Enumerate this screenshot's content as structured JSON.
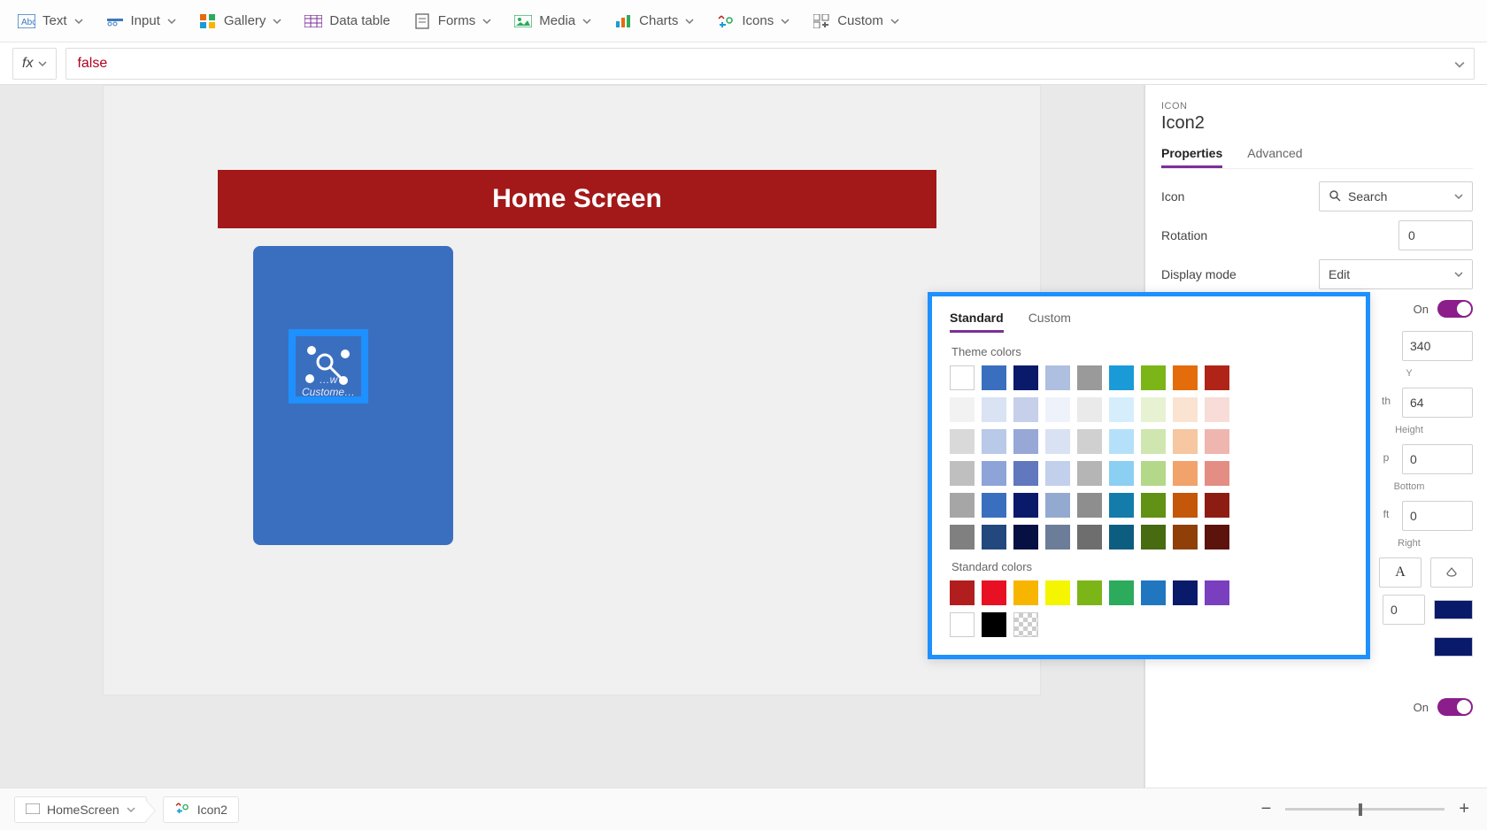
{
  "ribbon": {
    "items": [
      {
        "label": "Text",
        "icon": "text-icon"
      },
      {
        "label": "Input",
        "icon": "input-icon"
      },
      {
        "label": "Gallery",
        "icon": "gallery-icon"
      },
      {
        "label": "Data table",
        "icon": "datatable-icon"
      },
      {
        "label": "Forms",
        "icon": "forms-icon"
      },
      {
        "label": "Media",
        "icon": "media-icon"
      },
      {
        "label": "Charts",
        "icon": "charts-icon"
      },
      {
        "label": "Icons",
        "icon": "icons-icon"
      },
      {
        "label": "Custom",
        "icon": "custom-icon"
      }
    ]
  },
  "formula": {
    "fx_label": "fx",
    "value": "false"
  },
  "canvas": {
    "header_title": "Home Screen",
    "card_caption": "…w Custome…"
  },
  "properties": {
    "category_label": "ICON",
    "object_name": "Icon2",
    "tabs": {
      "properties": "Properties",
      "advanced": "Advanced"
    },
    "rows": {
      "icon_label": "Icon",
      "icon_value": "Search",
      "rotation_label": "Rotation",
      "rotation_value": "0",
      "display_mode_label": "Display mode",
      "display_mode_value": "Edit"
    },
    "toggle_on": "On",
    "right_values": {
      "y_value": "340",
      "y_label": "Y",
      "h_value": "64",
      "h_hint_left": "th",
      "h_label": "Height",
      "b_value": "0",
      "b_hint_left": "p",
      "b_label": "Bottom",
      "r_value": "0",
      "r_hint_left": "ft",
      "r_label": "Right",
      "extra_zero": "0",
      "swatch1": "#0a1a6b",
      "swatch2": "#0a1a6b"
    },
    "footer_toggle": "On"
  },
  "color_picker": {
    "tabs": {
      "standard": "Standard",
      "custom": "Custom"
    },
    "theme_label": "Theme colors",
    "standard_label": "Standard colors",
    "theme_colors": [
      "#ffffff",
      "#3a6fbf",
      "#0a1a6b",
      "#aebfe0",
      "#9a9a9a",
      "#1a9bd7",
      "#7cb518",
      "#e46c0a",
      "#b02418",
      "#f2f2f2",
      "#d9e3f3",
      "#c6d0ea",
      "#eef2fa",
      "#eaeaea",
      "#d6eefc",
      "#e6f2d1",
      "#fbe3d2",
      "#f7dcd8",
      "#d9d9d9",
      "#b9c9e8",
      "#97a7d6",
      "#d9e2f3",
      "#d0d0d0",
      "#b4e1f9",
      "#d0e6b0",
      "#f6c7a0",
      "#efb6af",
      "#bfbfbf",
      "#8ea3d8",
      "#6177be",
      "#c2d0ec",
      "#b5b5b5",
      "#8bcff3",
      "#b4d889",
      "#f2a26b",
      "#e38d84",
      "#a6a6a6",
      "#3a6fbf",
      "#0a1a6b",
      "#94a9cf",
      "#8e8e8e",
      "#147caa",
      "#619115",
      "#c4570a",
      "#8d1d13",
      "#808080",
      "#23487e",
      "#061042",
      "#6b7d99",
      "#6e6e6e",
      "#0d5d80",
      "#466b10",
      "#8f3f07",
      "#5b130c"
    ],
    "standard_colors": [
      "#b21e1e",
      "#e81123",
      "#f7b500",
      "#f5f500",
      "#7cb518",
      "#2bab5b",
      "#2176c0",
      "#0a1a6b",
      "#7a3fbf",
      "#ffffff",
      "#000000"
    ]
  },
  "bottom": {
    "crumb1": "HomeScreen",
    "crumb2": "Icon2"
  }
}
